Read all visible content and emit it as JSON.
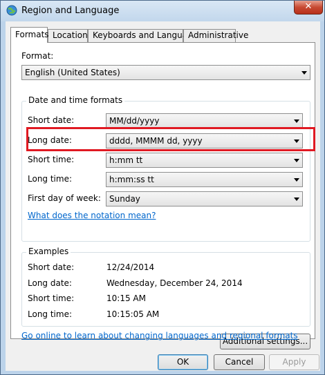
{
  "window": {
    "title": "Region and Language",
    "close_glyph": "✕"
  },
  "tabs": [
    {
      "label": "Formats",
      "active": true
    },
    {
      "label": "Location",
      "active": false
    },
    {
      "label": "Keyboards and Languages",
      "active": false
    },
    {
      "label": "Administrative",
      "active": false
    }
  ],
  "format": {
    "label": "Format:",
    "value": "English (United States)"
  },
  "date_time_formats": {
    "title": "Date and time formats",
    "short_date": {
      "label": "Short date:",
      "value": "MM/dd/yyyy"
    },
    "long_date": {
      "label": "Long date:",
      "value": "dddd, MMMM dd, yyyy"
    },
    "short_time": {
      "label": "Short time:",
      "value": "h:mm tt"
    },
    "long_time": {
      "label": "Long time:",
      "value": "h:mm:ss tt"
    },
    "first_day": {
      "label": "First day of week:",
      "value": "Sunday"
    },
    "notation_link": "What does the notation mean?"
  },
  "examples": {
    "title": "Examples",
    "short_date": {
      "label": "Short date:",
      "value": "12/24/2014"
    },
    "long_date": {
      "label": "Long date:",
      "value": "Wednesday, December 24, 2014"
    },
    "short_time": {
      "label": "Short time:",
      "value": "10:15 AM"
    },
    "long_time": {
      "label": "Long time:",
      "value": "10:15:05 AM"
    }
  },
  "additional_settings": "Additional settings...",
  "online_link": "Go online to learn about changing languages and regional formats",
  "buttons": {
    "ok": "OK",
    "cancel": "Cancel",
    "apply": "Apply"
  },
  "highlight_color": "#e01922",
  "link_color": "#0066cc"
}
